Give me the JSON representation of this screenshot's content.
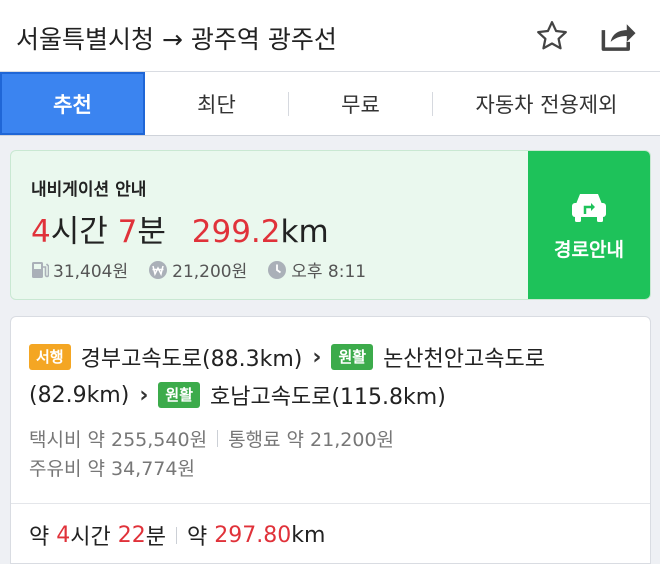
{
  "header": {
    "origin": "서울특별시청",
    "arrow": "→",
    "destination": "광주역 광주선",
    "star_icon": "star-icon",
    "share_icon": "share-icon"
  },
  "tabs": [
    {
      "label": "추천",
      "active": true
    },
    {
      "label": "최단",
      "active": false
    },
    {
      "label": "무료",
      "active": false
    },
    {
      "label": "자동차 전용제외",
      "active": false
    }
  ],
  "navigation": {
    "label": "내비게이션 안내",
    "hours": "4",
    "hours_unit": "시간",
    "minutes": "7",
    "minutes_unit": "분",
    "distance": "299.2",
    "distance_unit": "km",
    "fuel_cost": "31,404원",
    "toll_cost": "21,200원",
    "arrival": "오후 8:11",
    "guide_button": "경로안내",
    "accent_color": "#1ec25a",
    "highlight_color": "#e0323a"
  },
  "route": {
    "roads_line1": {
      "badge1": "서행",
      "road1": "경부고속도로(88.3km)",
      "arrow": "›",
      "badge2": "원활",
      "road2": "논산천안고속도로"
    },
    "roads_line2": {
      "road2_cont": "(82.9km)",
      "arrow": "›",
      "badge3": "원활",
      "road3": "호남고속도로(115.8km)"
    },
    "taxi_fare": "택시비 약 255,540원",
    "toll_fare": "통행료 약 21,200원",
    "fuel_fare": "주유비 약 34,774원",
    "summary": {
      "prefix1": "약",
      "hours": "4",
      "hours_unit": "시간",
      "minutes": "22",
      "minutes_unit": "분",
      "prefix2": "약",
      "distance": "297.80",
      "distance_unit": "km"
    }
  }
}
